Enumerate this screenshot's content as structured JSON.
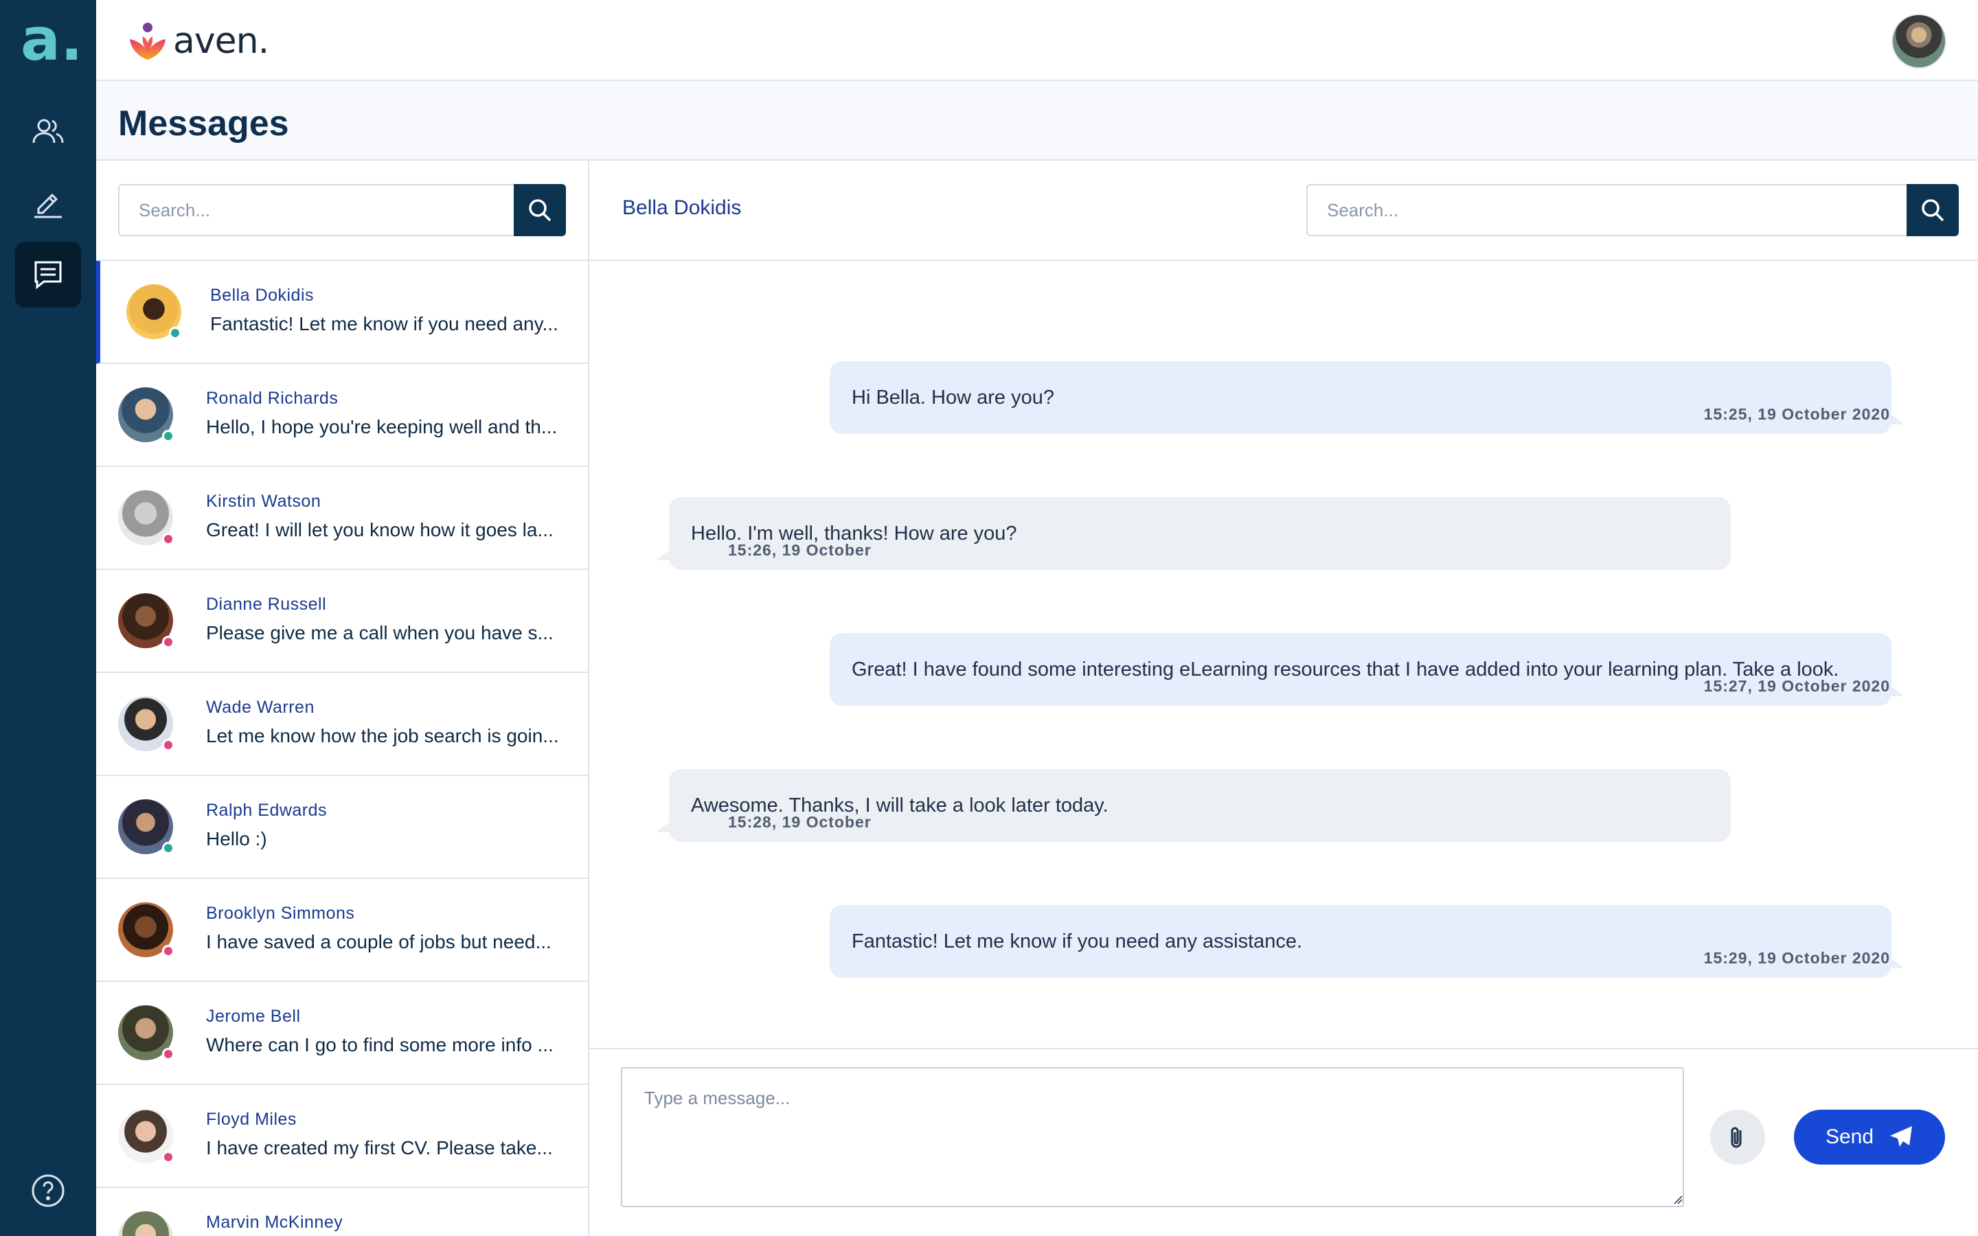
{
  "app": {
    "brand_name": "aven.",
    "rail_logo": "a."
  },
  "colors": {
    "rail": "#0c3350",
    "accent_blue": "#1848d6",
    "status_online": "#2aa897",
    "status_busy": "#e0457b"
  },
  "rail": {
    "items": [
      {
        "icon": "people-icon",
        "active": false
      },
      {
        "icon": "pen-signature-icon",
        "active": false
      },
      {
        "icon": "chat-icon",
        "active": true
      }
    ],
    "help_icon": "help-circle-icon"
  },
  "header": {
    "page_title": "Messages"
  },
  "contacts": {
    "search_placeholder": "Search...",
    "items": [
      {
        "name": "Bella Dokidis",
        "preview": "Fantastic! Let me know if you need any...",
        "status": "online",
        "active": true
      },
      {
        "name": "Ronald Richards",
        "preview": "Hello, I hope you're keeping well and th...",
        "status": "online",
        "active": false
      },
      {
        "name": "Kirstin Watson",
        "preview": "Great! I will let you know how it goes la...",
        "status": "busy",
        "active": false
      },
      {
        "name": "Dianne Russell",
        "preview": "Please give me a call when you have s...",
        "status": "busy",
        "active": false
      },
      {
        "name": "Wade Warren",
        "preview": "Let me know how the job search is goin...",
        "status": "busy",
        "active": false
      },
      {
        "name": "Ralph Edwards",
        "preview": "Hello :)",
        "status": "online",
        "active": false
      },
      {
        "name": "Brooklyn Simmons",
        "preview": "I have saved a couple of jobs but need...",
        "status": "busy",
        "active": false
      },
      {
        "name": "Jerome Bell",
        "preview": "Where can I go to find some more info ...",
        "status": "busy",
        "active": false
      },
      {
        "name": "Floyd Miles",
        "preview": "I have created my first CV. Please take...",
        "status": "busy",
        "active": false
      },
      {
        "name": "Marvin McKinney",
        "preview": "",
        "status": "busy",
        "active": false
      }
    ]
  },
  "chat": {
    "contact_name": "Bella Dokidis",
    "search_placeholder": "Search...",
    "messages": [
      {
        "direction": "out",
        "text": "Hi Bella. How are you?",
        "time": "15:25, 19 October 2020"
      },
      {
        "direction": "in",
        "text": "Hello. I'm well, thanks! How are you?",
        "time": "15:26, 19 October"
      },
      {
        "direction": "out",
        "text": "Great! I have found some interesting eLearning resources that I have added into your learning plan. Take a look.",
        "time": "15:27, 19 October 2020"
      },
      {
        "direction": "in",
        "text": "Awesome. Thanks, I will take a look later today.",
        "time": "15:28, 19 October"
      },
      {
        "direction": "out",
        "text": "Fantastic! Let me know if you need any assistance.",
        "time": "15:29, 19 October 2020"
      }
    ],
    "composer": {
      "placeholder": "Type a message...",
      "value": "",
      "send_label": "Send"
    }
  }
}
